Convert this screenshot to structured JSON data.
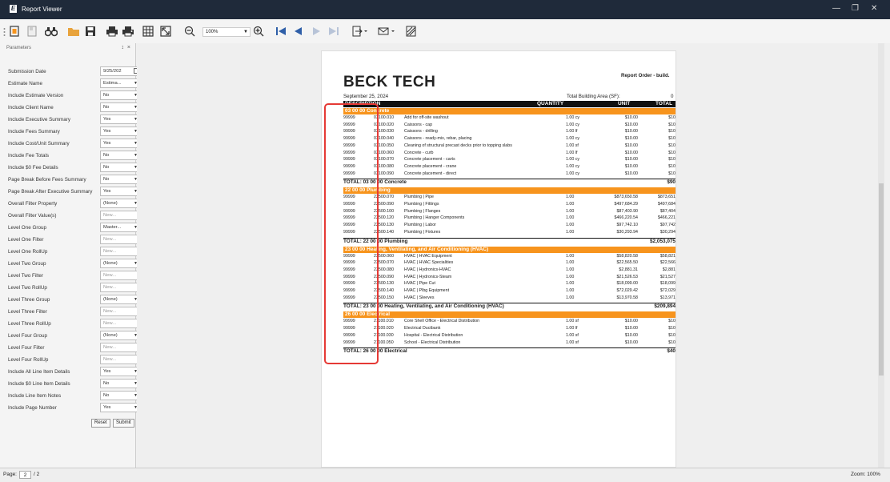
{
  "window": {
    "title": "Report Viewer",
    "app_icon": "E"
  },
  "toolbar": {
    "zoom": "100%"
  },
  "panel": {
    "title": "Parameters",
    "pin": "↕",
    "close": "×",
    "params": [
      {
        "label": "Submission Date",
        "value": "9/25/202",
        "kind": "date"
      },
      {
        "label": "Estimate Name",
        "value": "Estima...",
        "kind": "select"
      },
      {
        "label": "Include Estimate Version",
        "value": "No",
        "kind": "select"
      },
      {
        "label": "Include Client Name",
        "value": "No",
        "kind": "select"
      },
      {
        "label": "Include Executive Summary",
        "value": "Yes",
        "kind": "select"
      },
      {
        "label": "Include Fees Summary",
        "value": "Yes",
        "kind": "select"
      },
      {
        "label": "Include Cost/Unit Summary",
        "value": "Yes",
        "kind": "select"
      },
      {
        "label": "Include Fee Totals",
        "value": "No",
        "kind": "select"
      },
      {
        "label": "Include $0 Fee Details",
        "value": "No",
        "kind": "select"
      },
      {
        "label": "Page Break Before Fees Summary",
        "value": "No",
        "kind": "select"
      },
      {
        "label": "Page Break After Executive Summary",
        "value": "Yes",
        "kind": "select"
      },
      {
        "label": "Overall Filter Property",
        "value": "(None)",
        "kind": "select"
      },
      {
        "label": "Overall Filter Value(s)",
        "value": "New...",
        "kind": "text"
      },
      {
        "label": "Level One Group",
        "value": "Master...",
        "kind": "select"
      },
      {
        "label": "Level One Filter",
        "value": "New...",
        "kind": "text"
      },
      {
        "label": "Level One RollUp",
        "value": "New...",
        "kind": "text"
      },
      {
        "label": "Level Two Group",
        "value": "(None)",
        "kind": "select"
      },
      {
        "label": "Level Two Filter",
        "value": "New...",
        "kind": "text"
      },
      {
        "label": "Level Two RollUp",
        "value": "New...",
        "kind": "text"
      },
      {
        "label": "Level Three Group",
        "value": "(None)",
        "kind": "select"
      },
      {
        "label": "Level Three Filter",
        "value": "New...",
        "kind": "text"
      },
      {
        "label": "Level Three RollUp",
        "value": "New...",
        "kind": "text"
      },
      {
        "label": "Level Four Group",
        "value": "(None)",
        "kind": "select"
      },
      {
        "label": "Level Four Filter",
        "value": "New...",
        "kind": "text"
      },
      {
        "label": "Level Four RollUp",
        "value": "New...",
        "kind": "text"
      },
      {
        "label": "Include All Line Item Details",
        "value": "Yes",
        "kind": "select"
      },
      {
        "label": "Include $0 Line Item Details",
        "value": "No",
        "kind": "select"
      },
      {
        "label": "Include Line Item Notes",
        "value": "No",
        "kind": "select"
      },
      {
        "label": "Include Page Number",
        "value": "Yes",
        "kind": "select"
      }
    ],
    "reset_label": "Reset",
    "submit_label": "Submit"
  },
  "report": {
    "logo": "BECK TECH",
    "report_title": "Report Order - build.",
    "date": "September 25, 2024",
    "area_label": "Total Building Area (SF):",
    "area_value": "0",
    "headers": {
      "description": "DESCRIPTION",
      "quantity": "QUANTITY",
      "unit": "UNIT",
      "total": "TOTAL"
    },
    "sections": [
      {
        "title": "03 00 00 Concrete",
        "rows": [
          [
            "99999",
            "03100.010",
            "Add for off-site washout",
            "1.00 cy",
            "$10.00",
            "$10"
          ],
          [
            "99999",
            "03100.020",
            "Caissons - cap",
            "1.00 cy",
            "$10.00",
            "$10"
          ],
          [
            "99999",
            "03100.030",
            "Caissons - drilling",
            "1.00 lf",
            "$10.00",
            "$10"
          ],
          [
            "99999",
            "03100.040",
            "Caissons - ready-mix, rebar, placing",
            "1.00 cy",
            "$10.00",
            "$10"
          ],
          [
            "99999",
            "03100.050",
            "Cleaning of structural precast decks prior to topping slabs",
            "1.00 sf",
            "$10.00",
            "$10"
          ],
          [
            "99999",
            "03100.060",
            "Concrete - curb",
            "1.00 lf",
            "$10.00",
            "$10"
          ],
          [
            "99999",
            "03100.070",
            "Concrete placement - carts",
            "1.00 cy",
            "$10.00",
            "$10"
          ],
          [
            "99999",
            "03100.080",
            "Concrete placement - crane",
            "1.00 cy",
            "$10.00",
            "$10"
          ],
          [
            "99999",
            "03100.090",
            "Concrete placement - direct",
            "1.00 cy",
            "$10.00",
            "$10"
          ]
        ],
        "total_label": "TOTAL: 03 00 00 Concrete",
        "total_value": "$90"
      },
      {
        "title": "22 00 00 Plumbing",
        "rows": [
          [
            "99999",
            "22500.070",
            "Plumbing | Pipe",
            "1.00",
            "$873,650.58",
            "$873,651"
          ],
          [
            "99999",
            "22500.090",
            "Plumbing | Fittings",
            "1.00",
            "$497,684.29",
            "$497,684"
          ],
          [
            "99999",
            "22500.100",
            "Plumbing | Flanges",
            "1.00",
            "$87,403.90",
            "$87,404"
          ],
          [
            "99999",
            "22500.120",
            "Plumbing | Hanger Components",
            "1.00",
            "$466,220.54",
            "$466,221"
          ],
          [
            "99999",
            "22500.130",
            "Plumbing | Labor",
            "1.00",
            "$97,742.10",
            "$97,742"
          ],
          [
            "99999",
            "22500.140",
            "Plumbing | Fixtures",
            "1.00",
            "$30,293.94",
            "$30,294"
          ]
        ],
        "total_label": "TOTAL: 22 00 00 Plumbing",
        "total_value": "$2,053,075"
      },
      {
        "title": "23 00 00 Heating, Ventilating, and Air Conditioning (HVAC)",
        "rows": [
          [
            "99999",
            "23500.060",
            "HVAC | HVAC Equipment",
            "1.00",
            "$58,820.58",
            "$58,821"
          ],
          [
            "99999",
            "23500.070",
            "HVAC | HVAC Specialities",
            "1.00",
            "$22,565.50",
            "$22,566"
          ],
          [
            "99999",
            "23500.080",
            "HVAC | Hydronics-HVAC",
            "1.00",
            "$2,881.31",
            "$2,881"
          ],
          [
            "99999",
            "23500.090",
            "HVAC | Hydronics-Steam",
            "1.00",
            "$21,526.53",
            "$21,527"
          ],
          [
            "99999",
            "23500.130",
            "HVAC | Pipe Cut",
            "1.00",
            "$18,099.00",
            "$18,099"
          ],
          [
            "99999",
            "23500.140",
            "HVAC | Plbg Equipment",
            "1.00",
            "$72,029.42",
            "$72,029"
          ],
          [
            "99999",
            "23500.150",
            "HVAC | Sleeves",
            "1.00",
            "$13,970.58",
            "$13,971"
          ]
        ],
        "total_label": "TOTAL: 23 00 00 Heating, Ventilating, and Air Conditioning (HVAC)",
        "total_value": "$209,894"
      },
      {
        "title": "26 00 00 Electrical",
        "rows": [
          [
            "99999",
            "21100.010",
            "Core Shell Office - Electrical Distribution",
            "1.00 sf",
            "$10.00",
            "$10"
          ],
          [
            "99999",
            "21100.020",
            "Electrical Ductbank",
            "1.00 lf",
            "$10.00",
            "$10"
          ],
          [
            "99999",
            "21100.030",
            "Hospital - Electrical Distribution",
            "1.00 sf",
            "$10.00",
            "$10"
          ],
          [
            "99999",
            "21100.050",
            "School - Electrical Distribution",
            "1.00 sf",
            "$10.00",
            "$10"
          ]
        ],
        "total_label": "TOTAL: 26 00 00 Electrical",
        "total_value": "$40"
      }
    ]
  },
  "status": {
    "page_label": "Page:",
    "page_value": "2",
    "page_total": "/ 2",
    "zoom": "Zoom: 100%"
  }
}
